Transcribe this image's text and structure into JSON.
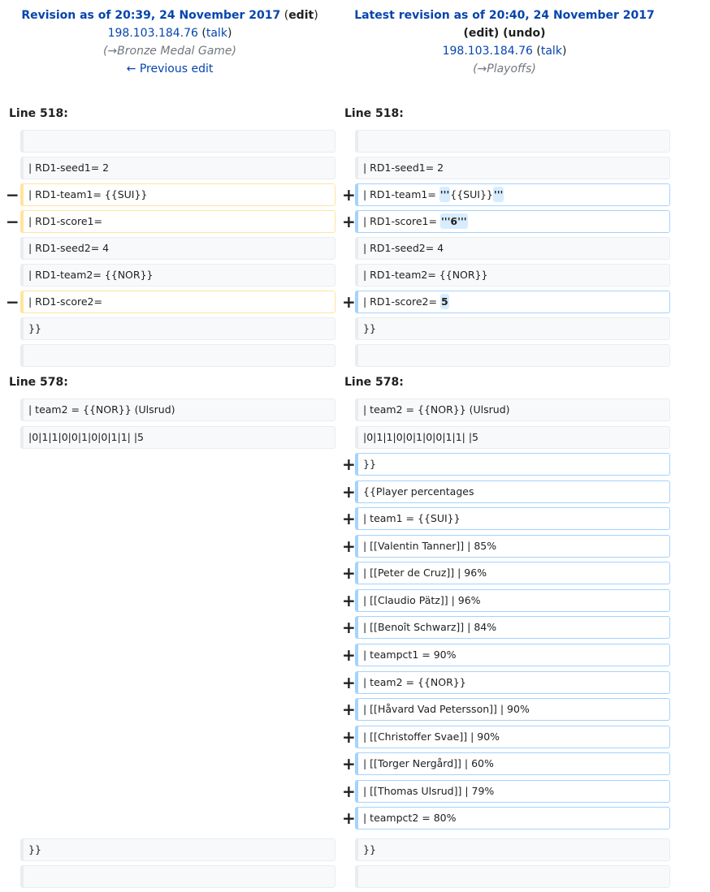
{
  "left_header": {
    "title": "Revision as of 20:39, 24 November 2017",
    "edit": "edit",
    "user": "198.103.184.76",
    "talk": "talk",
    "summary": "(→Bronze Medal Game)",
    "prev": "← Previous edit"
  },
  "right_header": {
    "title": "Latest revision as of 20:40, 24 November 2017",
    "edit": "edit",
    "undo": "undo",
    "user": "198.103.184.76",
    "talk": "talk",
    "summary": "(→Playoffs)"
  },
  "sections": [
    {
      "left_label": "Line 518:",
      "right_label": "Line 518:",
      "rows": [
        {
          "l": {
            "t": "ctx",
            "s": [
              {
                "x": ""
              }
            ]
          },
          "r": {
            "t": "ctx",
            "s": [
              {
                "x": ""
              }
            ]
          }
        },
        {
          "l": {
            "t": "ctx",
            "s": [
              {
                "x": "| RD1-seed1= 2"
              }
            ]
          },
          "r": {
            "t": "ctx",
            "s": [
              {
                "x": "| RD1-seed1= 2"
              }
            ]
          }
        },
        {
          "l": {
            "t": "del",
            "s": [
              {
                "x": "| RD1-team1= {{SUI}}"
              }
            ]
          },
          "r": {
            "t": "add",
            "s": [
              {
                "x": "| RD1-team1= "
              },
              {
                "x": "'''",
                "h": 1
              },
              {
                "x": "{{SUI}}"
              },
              {
                "x": "'''",
                "h": 1
              }
            ]
          }
        },
        {
          "l": {
            "t": "del",
            "s": [
              {
                "x": "| RD1-score1="
              }
            ]
          },
          "r": {
            "t": "add",
            "s": [
              {
                "x": "| RD1-score1= "
              },
              {
                "x": "'''6'''",
                "h": 1
              }
            ]
          }
        },
        {
          "l": {
            "t": "ctx",
            "s": [
              {
                "x": "| RD1-seed2= 4"
              }
            ]
          },
          "r": {
            "t": "ctx",
            "s": [
              {
                "x": "| RD1-seed2= 4"
              }
            ]
          }
        },
        {
          "l": {
            "t": "ctx",
            "s": [
              {
                "x": "| RD1-team2= {{NOR}}"
              }
            ]
          },
          "r": {
            "t": "ctx",
            "s": [
              {
                "x": "| RD1-team2= {{NOR}}"
              }
            ]
          }
        },
        {
          "l": {
            "t": "del",
            "s": [
              {
                "x": "| RD1-score2="
              }
            ]
          },
          "r": {
            "t": "add",
            "s": [
              {
                "x": "| RD1-score2= "
              },
              {
                "x": "5",
                "h": 1
              }
            ]
          }
        },
        {
          "l": {
            "t": "ctx",
            "s": [
              {
                "x": "}}"
              }
            ]
          },
          "r": {
            "t": "ctx",
            "s": [
              {
                "x": "}}"
              }
            ]
          }
        },
        {
          "l": {
            "t": "ctx",
            "s": [
              {
                "x": ""
              }
            ]
          },
          "r": {
            "t": "ctx",
            "s": [
              {
                "x": ""
              }
            ]
          }
        }
      ]
    },
    {
      "left_label": "Line 578:",
      "right_label": "Line 578:",
      "rows": [
        {
          "l": {
            "t": "ctx",
            "s": [
              {
                "x": "| team2 = {{NOR}} (Ulsrud)"
              }
            ]
          },
          "r": {
            "t": "ctx",
            "s": [
              {
                "x": "| team2 = {{NOR}} (Ulsrud)"
              }
            ]
          }
        },
        {
          "l": {
            "t": "ctx",
            "s": [
              {
                "x": "|0|1|1|0|0|1|0|0|1|1| |5"
              }
            ]
          },
          "r": {
            "t": "ctx",
            "s": [
              {
                "x": "|0|1|1|0|0|1|0|0|1|1| |5"
              }
            ]
          }
        },
        {
          "r": {
            "t": "add",
            "s": [
              {
                "x": "}}"
              }
            ]
          }
        },
        {
          "r": {
            "t": "add",
            "s": [
              {
                "x": "{{Player percentages"
              }
            ]
          }
        },
        {
          "r": {
            "t": "add",
            "s": [
              {
                "x": "| team1 = {{SUI}}"
              }
            ]
          }
        },
        {
          "r": {
            "t": "add",
            "s": [
              {
                "x": "| [[Valentin Tanner]] | 85%"
              }
            ]
          }
        },
        {
          "r": {
            "t": "add",
            "s": [
              {
                "x": "| [[Peter de Cruz]] | 96%"
              }
            ]
          }
        },
        {
          "r": {
            "t": "add",
            "s": [
              {
                "x": "| [[Claudio Pätz]] | 96%"
              }
            ]
          }
        },
        {
          "r": {
            "t": "add",
            "s": [
              {
                "x": "| [[Benoît Schwarz]] | 84%"
              }
            ]
          }
        },
        {
          "r": {
            "t": "add",
            "s": [
              {
                "x": "| teampct1 = 90%"
              }
            ]
          }
        },
        {
          "r": {
            "t": "add",
            "s": [
              {
                "x": "| team2 = {{NOR}}"
              }
            ]
          }
        },
        {
          "r": {
            "t": "add",
            "s": [
              {
                "x": "| [[Håvard Vad Petersson]] | 90%"
              }
            ]
          }
        },
        {
          "r": {
            "t": "add",
            "s": [
              {
                "x": "| [[Christoffer Svae]] | 90%"
              }
            ]
          }
        },
        {
          "r": {
            "t": "add",
            "s": [
              {
                "x": "| [[Torger Nergård]] | 60%"
              }
            ]
          }
        },
        {
          "r": {
            "t": "add",
            "s": [
              {
                "x": "| [[Thomas Ulsrud]] | 79%"
              }
            ]
          }
        },
        {
          "r": {
            "t": "add",
            "s": [
              {
                "x": "| teampct2 = 80%"
              }
            ]
          }
        },
        {
          "l": {
            "t": "ctx",
            "s": [
              {
                "x": "}}"
              }
            ]
          },
          "r": {
            "t": "ctx",
            "s": [
              {
                "x": "}}"
              }
            ]
          }
        },
        {
          "l": {
            "t": "ctx",
            "s": [
              {
                "x": ""
              }
            ]
          },
          "r": {
            "t": "ctx",
            "s": [
              {
                "x": ""
              }
            ]
          }
        }
      ]
    }
  ],
  "markers": {
    "del": "−",
    "add": "+"
  }
}
